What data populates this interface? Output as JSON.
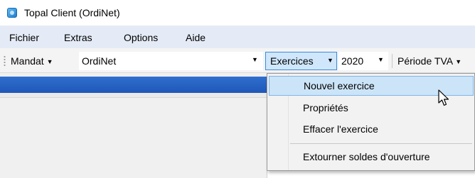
{
  "window": {
    "title": "Topal Client (OrdiNet)"
  },
  "menubar": {
    "items": [
      "Fichier",
      "Extras",
      "Options",
      "Aide"
    ]
  },
  "toolbar": {
    "mandat_label": "Mandat",
    "mandat_value": "OrdiNet",
    "exercices_label": "Exercices",
    "year_value": "2020",
    "periode_label": "Période TVA"
  },
  "dropdown": {
    "items": [
      {
        "label": "Nouvel exercice"
      },
      {
        "label": "Propriétés"
      },
      {
        "label": "Effacer l'exercice"
      },
      {
        "label": "Extourner soldes d'ouverture"
      }
    ]
  },
  "colors": {
    "menubar_bg": "#e4ebf6",
    "accent_blue": "#2f6fcf",
    "highlight": "#cce4f7"
  }
}
